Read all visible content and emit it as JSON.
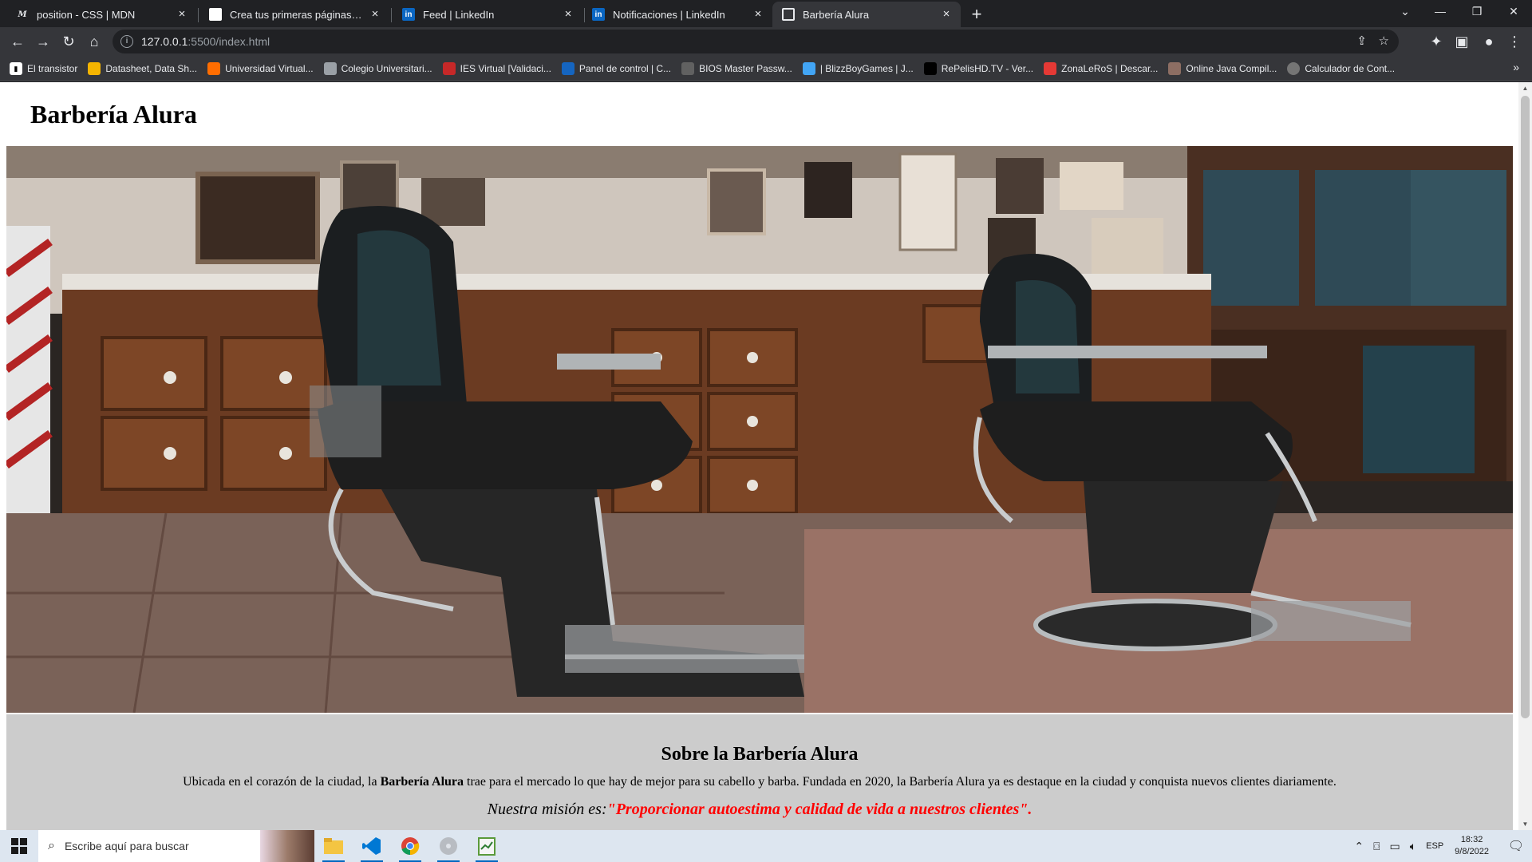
{
  "browser": {
    "tabs": [
      {
        "title": "position - CSS | MDN",
        "favicon": "mdn-icon",
        "active": false
      },
      {
        "title": "Crea tus primeras páginas web e",
        "favicon": "page-icon",
        "active": false
      },
      {
        "title": "Feed | LinkedIn",
        "favicon": "linkedin-icon",
        "active": false
      },
      {
        "title": "Notificaciones | LinkedIn",
        "favicon": "linkedin-icon",
        "active": false
      },
      {
        "title": "Barbería Alura",
        "favicon": "globe-icon",
        "active": true
      }
    ],
    "url_host": "127.0.0.1",
    "url_path": ":5500/index.html",
    "bookmarks": [
      {
        "label": "El transistor",
        "color": "#ffffff"
      },
      {
        "label": "Datasheet, Data Sh...",
        "color": "#f4b400"
      },
      {
        "label": "Universidad Virtual...",
        "color": "#ff6d00"
      },
      {
        "label": "Colegio Universitari...",
        "color": "#9aa0a6"
      },
      {
        "label": "IES Virtual [Validaci...",
        "color": "#c62828"
      },
      {
        "label": "Panel de control | C...",
        "color": "#1565c0"
      },
      {
        "label": "BIOS Master Passw...",
        "color": "#616161"
      },
      {
        "label": "| BlizzBoyGames | J...",
        "color": "#42a5f5"
      },
      {
        "label": "RePelisHD.TV - Ver...",
        "color": "#000000"
      },
      {
        "label": "ZonaLeRoS | Descar...",
        "color": "#e53935"
      },
      {
        "label": "Online Java Compil...",
        "color": "#8d6e63"
      },
      {
        "label": "Calculador de Cont...",
        "color": "#757575"
      }
    ]
  },
  "page": {
    "site_title": "Barbería Alura",
    "about_heading": "Sobre la Barbería Alura",
    "desc_before": "Ubicada en el corazón de la ciudad, la ",
    "desc_bold": "Barbería Alura",
    "desc_after": " trae para el mercado lo que hay de mejor para su cabello y barba. Fundada en 2020, la Barbería Alura ya es destaque en la ciudad y conquista nuevos clientes diariamente.",
    "mission_label": "Nuestra misión es:",
    "mission_quote": "\"Proporcionar autoestima y calidad de vida a nuestros clientes\".",
    "accent_color": "#ff0000"
  },
  "taskbar": {
    "search_placeholder": "Escribe aquí para buscar",
    "apps": [
      "file-explorer-icon",
      "vscode-icon",
      "chrome-icon",
      "disc-icon",
      "notepad-icon"
    ],
    "language": "ESP",
    "time": "18:32",
    "date": "9/8/2022"
  }
}
